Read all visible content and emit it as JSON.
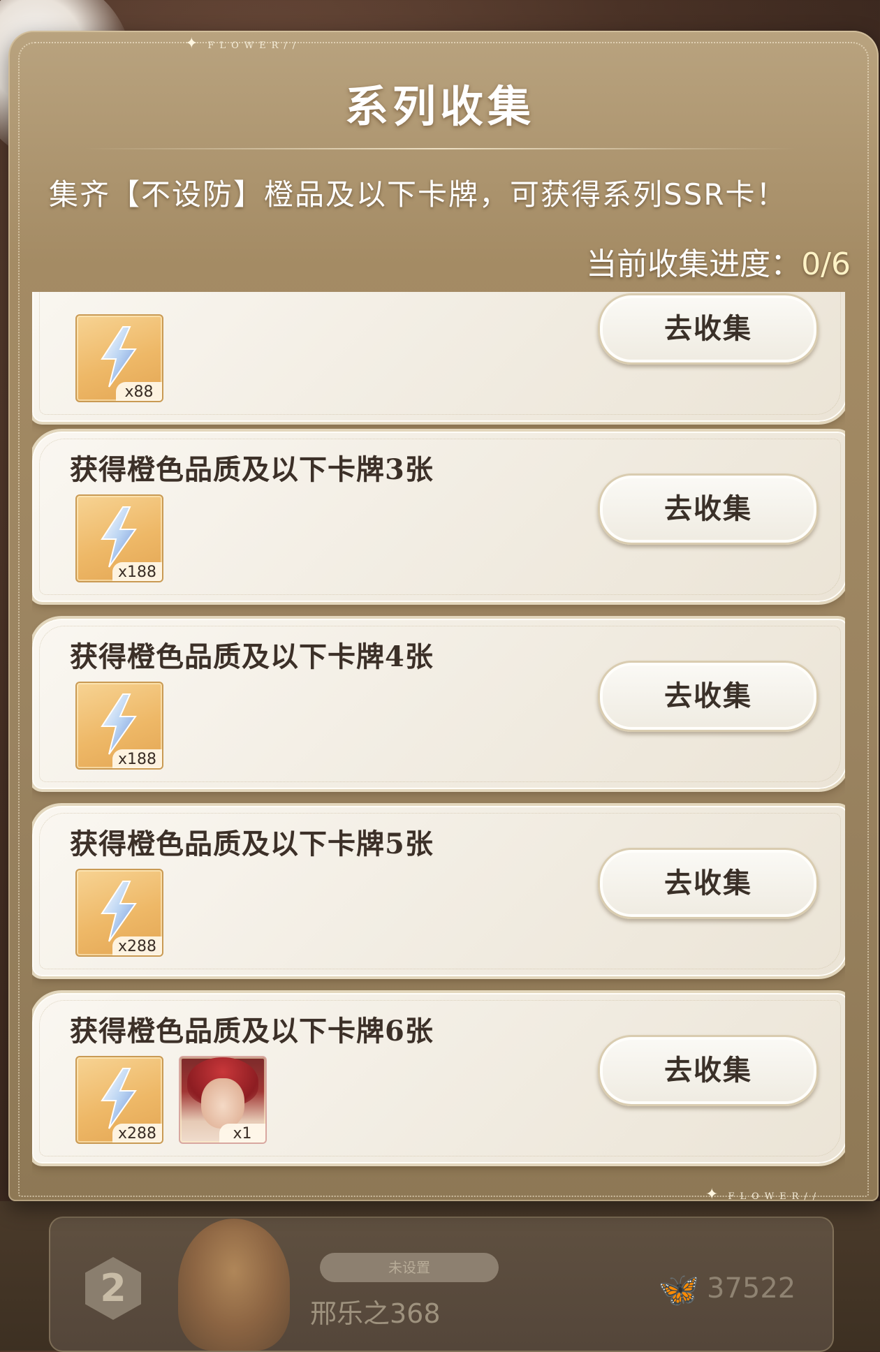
{
  "panel": {
    "title": "系列收集",
    "decor_label_top": "FLOWER//",
    "decor_label_bottom": "FLOWER//",
    "description": "集齐【不设防】橙品及以下卡牌，可获得系列SSR卡！",
    "progress_label": "当前收集进度：",
    "progress_value": "0/6"
  },
  "tasks": [
    {
      "title": "",
      "button_label": "去收集",
      "rewards": [
        {
          "icon": "lightning-energy-icon",
          "qty": "x88"
        }
      ]
    },
    {
      "title": "获得橙色品质及以下卡牌3张",
      "button_label": "去收集",
      "rewards": [
        {
          "icon": "lightning-energy-icon",
          "qty": "x188"
        }
      ]
    },
    {
      "title": "获得橙色品质及以下卡牌4张",
      "button_label": "去收集",
      "rewards": [
        {
          "icon": "lightning-energy-icon",
          "qty": "x188"
        }
      ]
    },
    {
      "title": "获得橙色品质及以下卡牌5张",
      "button_label": "去收集",
      "rewards": [
        {
          "icon": "lightning-energy-icon",
          "qty": "x288"
        }
      ]
    },
    {
      "title": "获得橙色品质及以下卡牌6张",
      "button_label": "去收集",
      "rewards": [
        {
          "icon": "lightning-energy-icon",
          "qty": "x288"
        },
        {
          "icon": "character-portrait-icon",
          "qty": "x1"
        }
      ]
    }
  ],
  "background_ranking": {
    "rank": "2",
    "status_pill": "未设置",
    "player_name": "邢乐之368",
    "score": "37522",
    "score_icon": "butterfly-icon"
  },
  "colors": {
    "panel": "#a48b64",
    "card": "#f4efe6",
    "reward_bg": "#eeb867",
    "text_dark": "#3c3028"
  }
}
